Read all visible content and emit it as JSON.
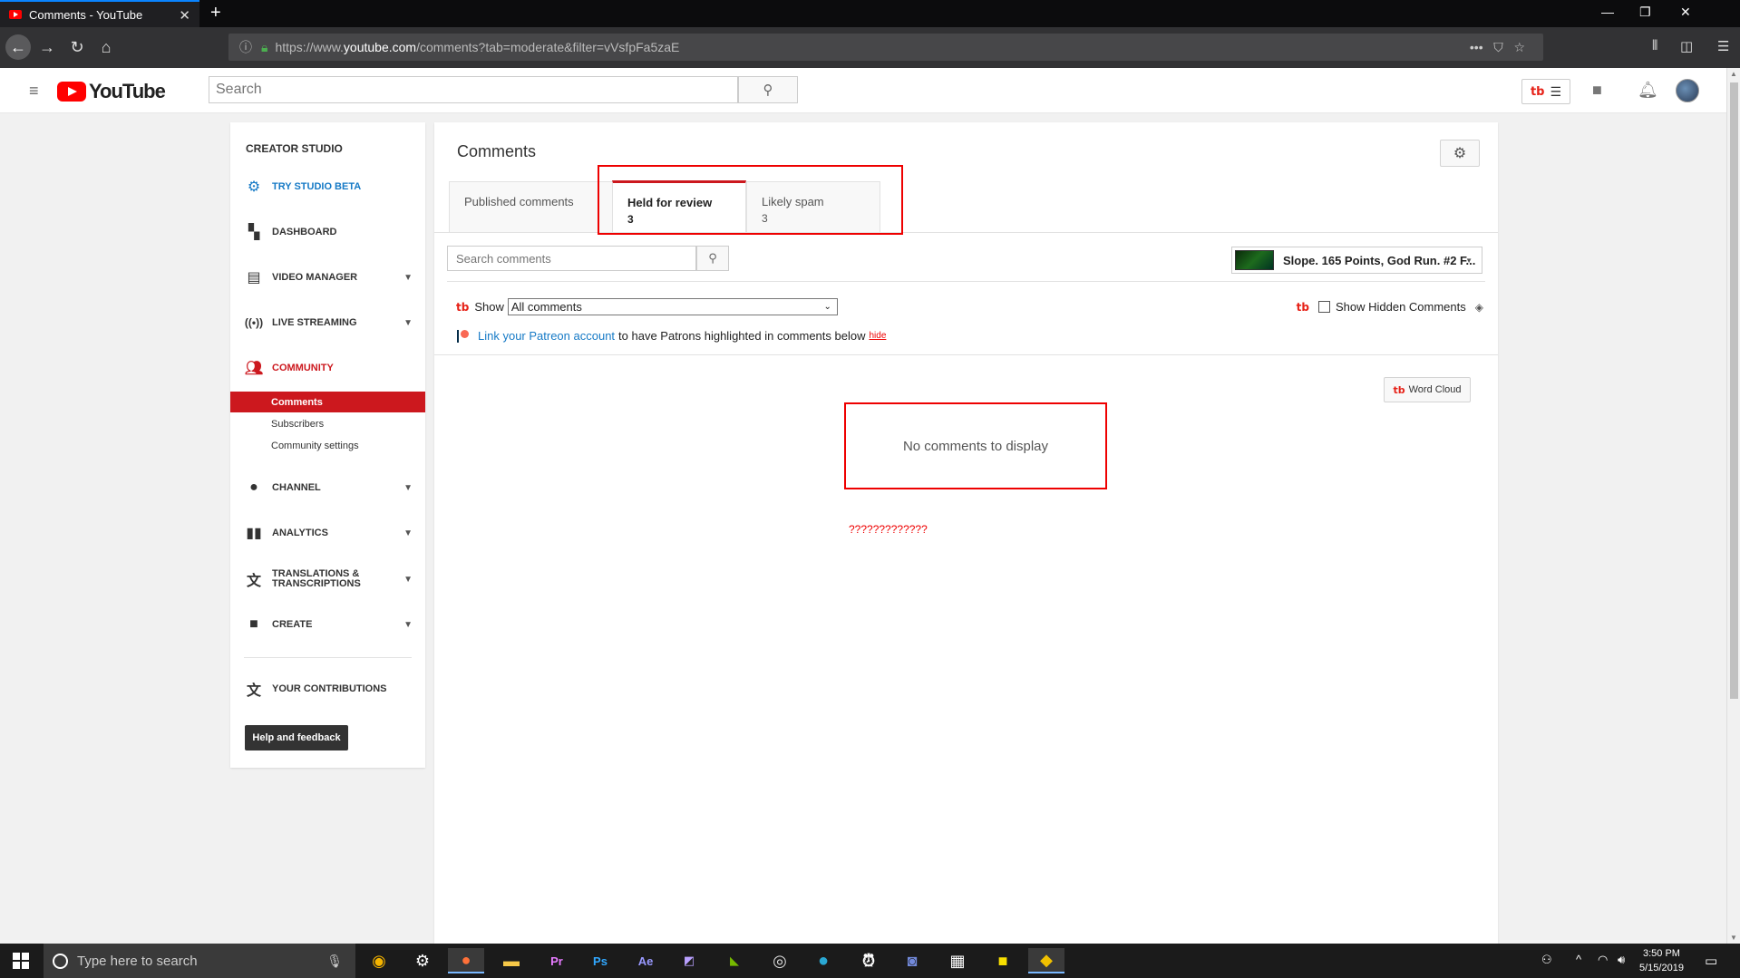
{
  "browser": {
    "tab_title": "Comments - YouTube",
    "url_base": "https://www.",
    "url_host": "youtube.com",
    "url_path": "/comments?tab=moderate&filter=vVsfpFa5zaE"
  },
  "header": {
    "logo_text": "YouTube",
    "search_placeholder": "Search"
  },
  "sidebar": {
    "title": "CREATOR STUDIO",
    "items": {
      "beta": "TRY STUDIO BETA",
      "dashboard": "DASHBOARD",
      "video_manager": "VIDEO MANAGER",
      "live_streaming": "LIVE STREAMING",
      "community": "COMMUNITY",
      "channel": "CHANNEL",
      "analytics": "ANALYTICS",
      "translations_line1": "TRANSLATIONS &",
      "translations_line2": "TRANSCRIPTIONS",
      "create": "CREATE",
      "contributions": "YOUR CONTRIBUTIONS"
    },
    "community_sub": {
      "comments": "Comments",
      "subscribers": "Subscribers",
      "settings": "Community settings"
    },
    "help_button": "Help and feedback"
  },
  "main": {
    "title": "Comments",
    "tabs": {
      "published": "Published comments",
      "held": "Held for review",
      "held_count": "3",
      "spam": "Likely spam",
      "spam_count": "3"
    },
    "search_placeholder": "Search comments",
    "video_title": "Slope. 165 Points, God Run. #2 F...",
    "show_label": "Show",
    "show_value": "All comments",
    "show_hidden_label": "Show Hidden Comments",
    "patreon_link": "Link your Patreon account",
    "patreon_text": "to have Patrons highlighted in comments below",
    "patreon_hide": "hide",
    "word_cloud": "Word Cloud",
    "empty_message": "No comments to display",
    "annotation": "?????????????"
  },
  "taskbar": {
    "search_placeholder": "Type here to search",
    "time": "3:50 PM",
    "date": "5/15/2019"
  },
  "colors": {
    "accent_red": "#cc181e",
    "annotation_red": "#ee0000",
    "link_blue": "#167ac6"
  }
}
